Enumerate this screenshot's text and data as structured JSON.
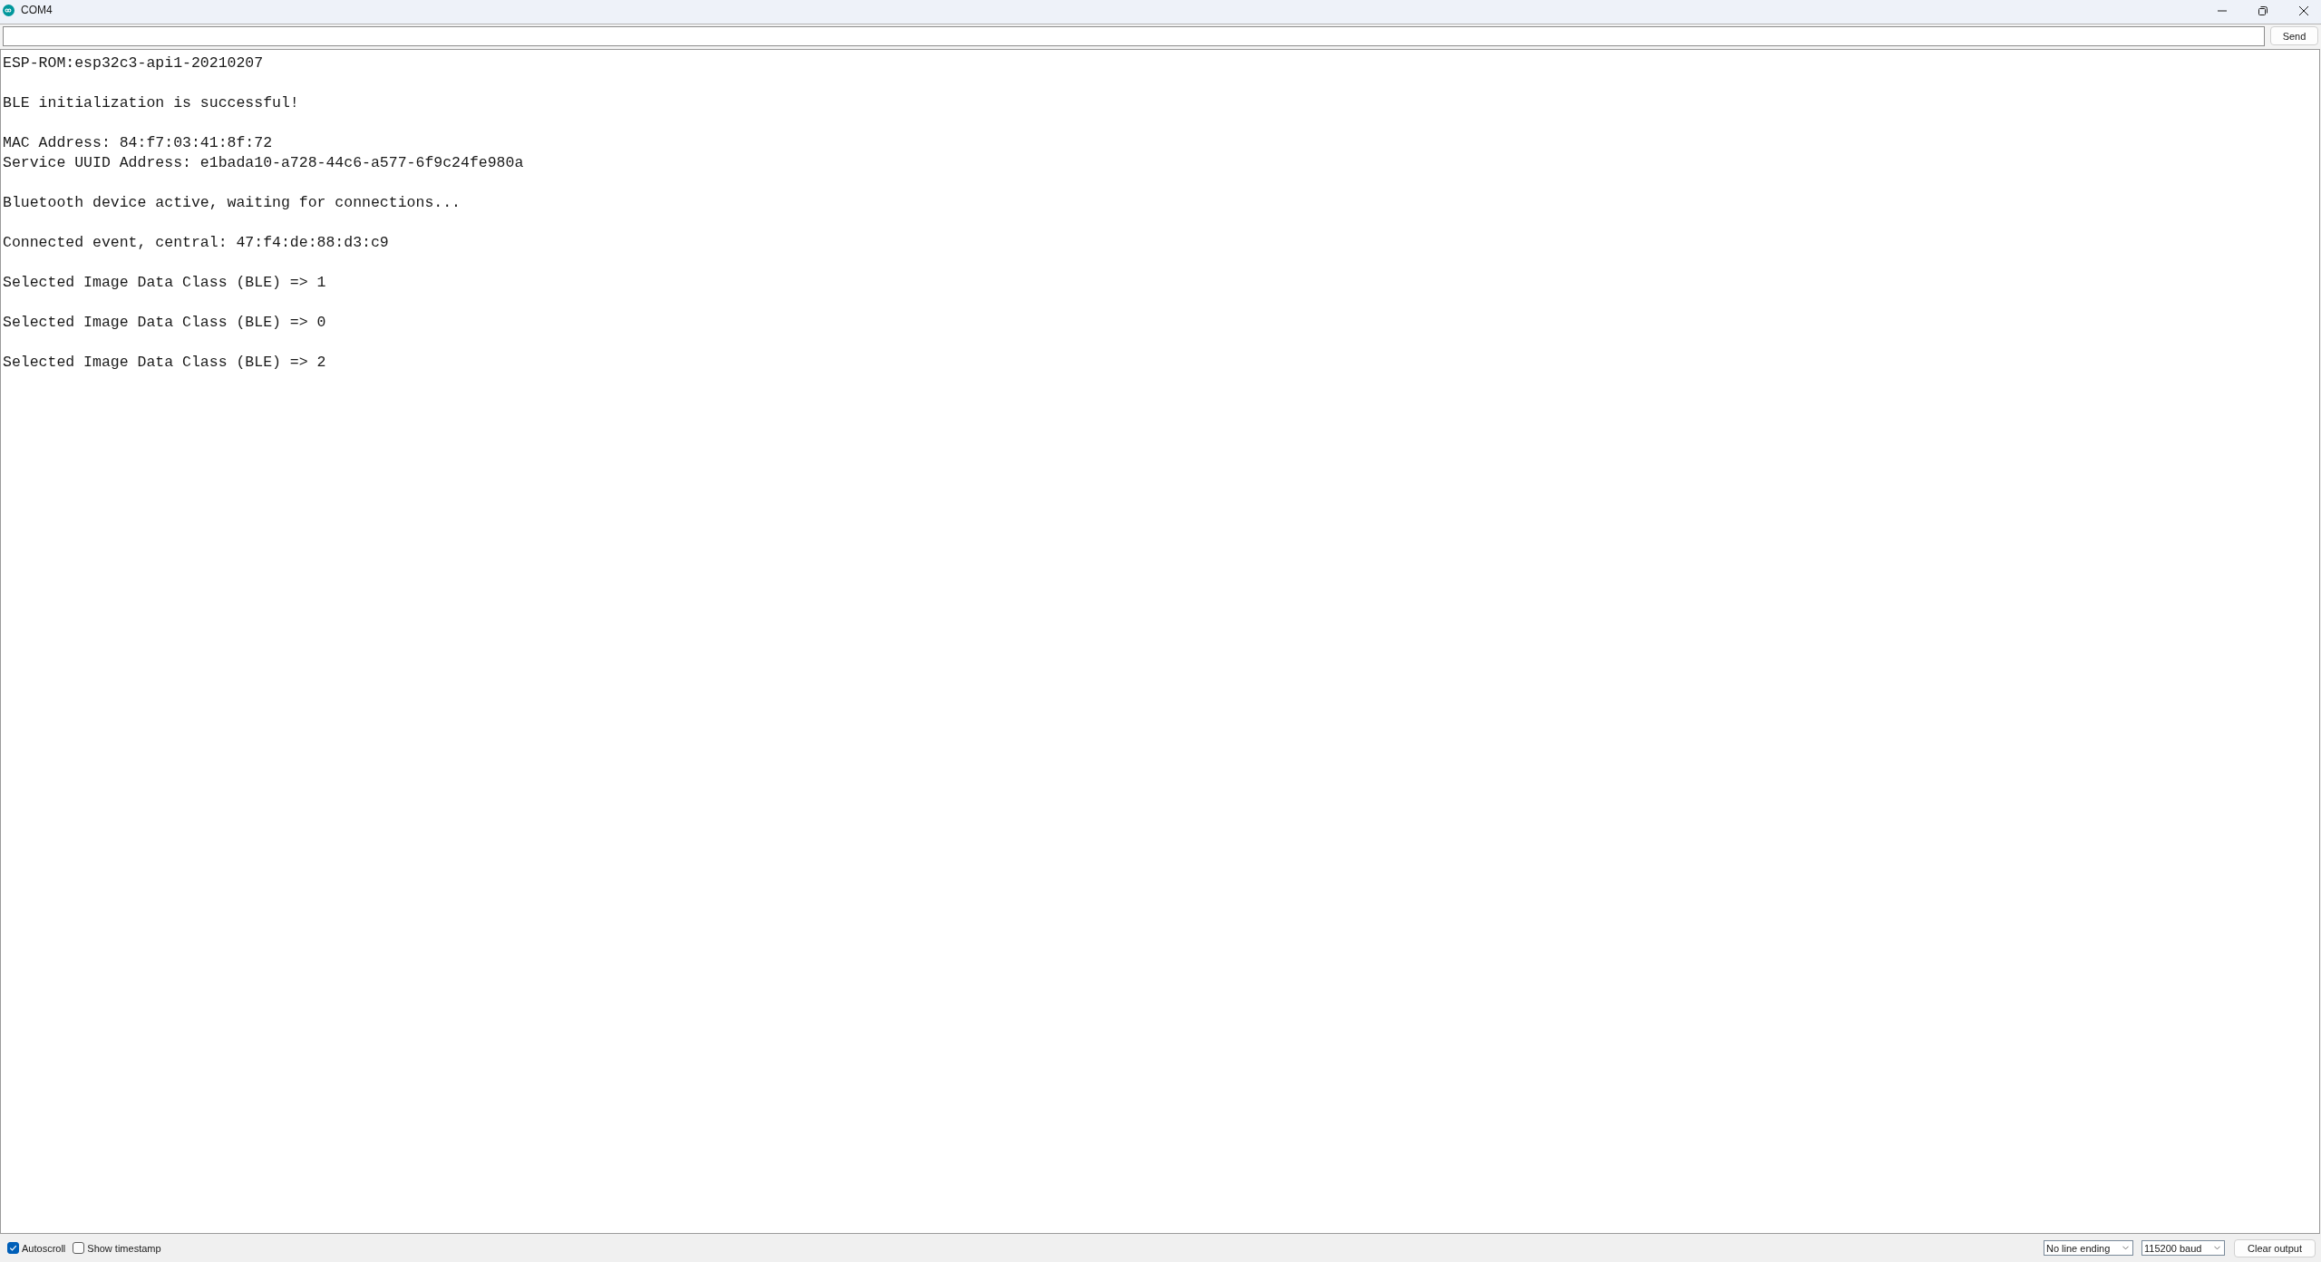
{
  "window": {
    "title": "COM4"
  },
  "send_bar": {
    "send_button": "Send"
  },
  "output": {
    "messages": [
      [
        "ESP-ROM:esp32c3-api1-20210207"
      ],
      [
        "BLE initialization is successful!"
      ],
      [
        "MAC Address: 84:f7:03:41:8f:72",
        "Service UUID Address: e1bada10-a728-44c6-a577-6f9c24fe980a"
      ],
      [
        "Bluetooth device active, waiting for connections..."
      ],
      [
        "Connected event, central: 47:f4:de:88:d3:c9"
      ],
      [
        "Selected Image Data Class (BLE) => 1"
      ],
      [
        "Selected Image Data Class (BLE) => 0"
      ],
      [
        "Selected Image Data Class (BLE) => 2"
      ]
    ]
  },
  "footer": {
    "checkboxes": [
      {
        "label": "Autoscroll",
        "checked": true
      },
      {
        "label": "Show timestamp",
        "checked": false
      }
    ],
    "line_ending": "No line ending",
    "baud_rate": "115200 baud",
    "clear_button": "Clear output"
  }
}
